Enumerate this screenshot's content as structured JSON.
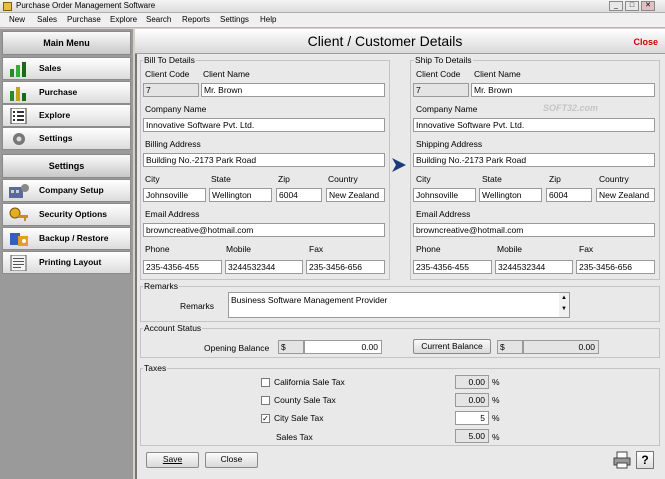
{
  "window": {
    "title": "Purchase Order Management Software"
  },
  "menu": [
    "New",
    "Sales",
    "Purchase",
    "Explore",
    "Search",
    "Reports",
    "Settings",
    "Help"
  ],
  "sidebar": {
    "main_header": "Main Menu",
    "main_items": [
      "Sales",
      "Purchase",
      "Explore",
      "Settings"
    ],
    "settings_header": "Settings",
    "settings_items": [
      "Company Setup",
      "Security Options",
      "Backup / Restore",
      "Printing Layout"
    ]
  },
  "page": {
    "title": "Client / Customer Details",
    "close_label": "Close"
  },
  "bill_to": {
    "group_label": "Bill To Details",
    "client_code_label": "Client Code",
    "client_code": "7",
    "client_name_label": "Client Name",
    "client_name": "Mr. Brown",
    "company_name_label": "Company Name",
    "company_name": "Innovative Software Pvt. Ltd.",
    "address_label": "Billing Address",
    "address": "Building No.-2173 Park Road",
    "city_label": "City",
    "city": "Johnsoville",
    "state_label": "State",
    "state": "Wellington",
    "zip_label": "Zip",
    "zip": "6004",
    "country_label": "Country",
    "country": "New Zealand",
    "email_label": "Email Address",
    "email": "browncreative@hotmail.com",
    "phone_label": "Phone",
    "phone": "235-4356-455",
    "mobile_label": "Mobile",
    "mobile": "3244532344",
    "fax_label": "Fax",
    "fax": "235-3456-656"
  },
  "ship_to": {
    "group_label": "Ship To Details",
    "client_code_label": "Client Code",
    "client_code": "7",
    "client_name_label": "Client Name",
    "client_name": "Mr. Brown",
    "company_name_label": "Company Name",
    "company_name": "Innovative Software Pvt. Ltd.",
    "address_label": "Shipping Address",
    "address": "Building No.-2173 Park Road",
    "city_label": "City",
    "city": "Johnsoville",
    "state_label": "State",
    "state": "Wellington",
    "zip_label": "Zip",
    "zip": "6004",
    "country_label": "Country",
    "country": "New Zealand",
    "email_label": "Email Address",
    "email": "browncreative@hotmail.com",
    "phone_label": "Phone",
    "phone": "235-4356-455",
    "mobile_label": "Mobile",
    "mobile": "3244532344",
    "fax_label": "Fax",
    "fax": "235-3456-656"
  },
  "watermark": "SOFT32.com",
  "remarks": {
    "group_label": "Remarks",
    "label": "Remarks",
    "value": "Business Software Management Provider"
  },
  "account": {
    "group_label": "Account Status",
    "opening_label": "Opening Balance",
    "currency": "$",
    "opening_value": "0.00",
    "current_button": "Current Balance",
    "current_value": "0.00"
  },
  "taxes": {
    "group_label": "Taxes",
    "items": [
      {
        "label": "California Sale Tax",
        "checked": false,
        "value": "0.00",
        "unit": "%"
      },
      {
        "label": "County Sale Tax",
        "checked": false,
        "value": "0.00",
        "unit": "%"
      },
      {
        "label": "City Sale Tax",
        "checked": true,
        "value": "5",
        "unit": "%"
      }
    ],
    "sales_tax_label": "Sales Tax",
    "sales_tax_value": "5.00",
    "sales_tax_unit": "%"
  },
  "footer": {
    "save": "Save",
    "close": "Close"
  },
  "colors": {
    "close_text": "#d00000",
    "arrow": "#1a3a7a"
  }
}
